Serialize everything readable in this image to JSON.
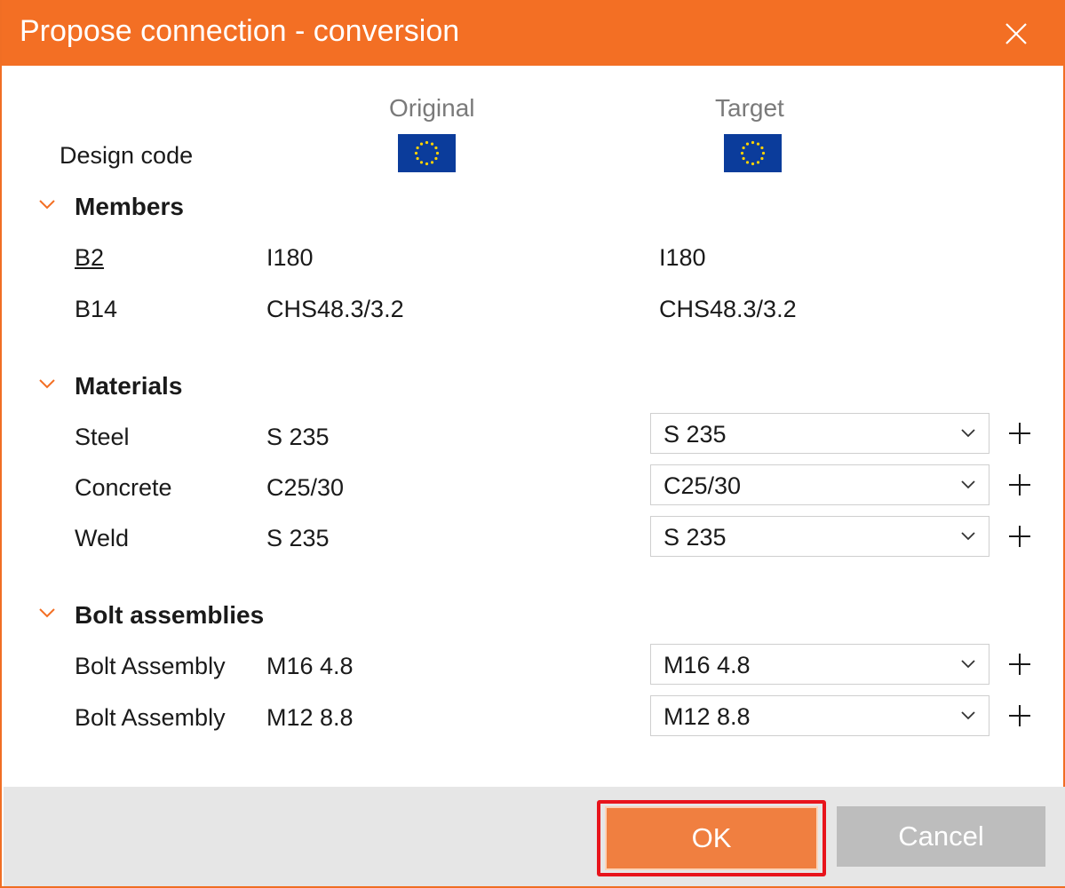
{
  "dialog": {
    "title": "Propose connection - conversion",
    "close_icon": "close-icon"
  },
  "columns": {
    "original": "Original",
    "target": "Target"
  },
  "design_code": {
    "label": "Design code",
    "original_flag": "eu-flag-icon",
    "target_flag": "eu-flag-icon",
    "flag_colors": {
      "blue": "#0b3c9b",
      "stars": "#ffd200"
    }
  },
  "members": {
    "header": "Members",
    "rows": [
      {
        "name": "B2",
        "original": "I180",
        "target": "I180"
      },
      {
        "name": "B14",
        "original": "CHS48.3/3.2",
        "target": "CHS48.3/3.2"
      }
    ]
  },
  "materials": {
    "header": "Materials",
    "rows": [
      {
        "name": "Steel",
        "original": "S 235",
        "target": "S 235"
      },
      {
        "name": "Concrete",
        "original": "C25/30",
        "target": "C25/30"
      },
      {
        "name": "Weld",
        "original": "S 235",
        "target": "S 235"
      }
    ]
  },
  "bolt_assemblies": {
    "header": "Bolt assemblies",
    "rows": [
      {
        "name": "Bolt Assembly",
        "original": "M16 4.8",
        "target": "M16 4.8"
      },
      {
        "name": "Bolt Assembly",
        "original": "M12 8.8",
        "target": "M12 8.8"
      }
    ]
  },
  "buttons": {
    "ok": "OK",
    "cancel": "Cancel"
  },
  "colors": {
    "accent": "#f36f24",
    "ok_button": "#f07f40",
    "highlight": "#e8141c",
    "cancel_button": "#bdbdbd",
    "footer": "#e6e6e6"
  }
}
